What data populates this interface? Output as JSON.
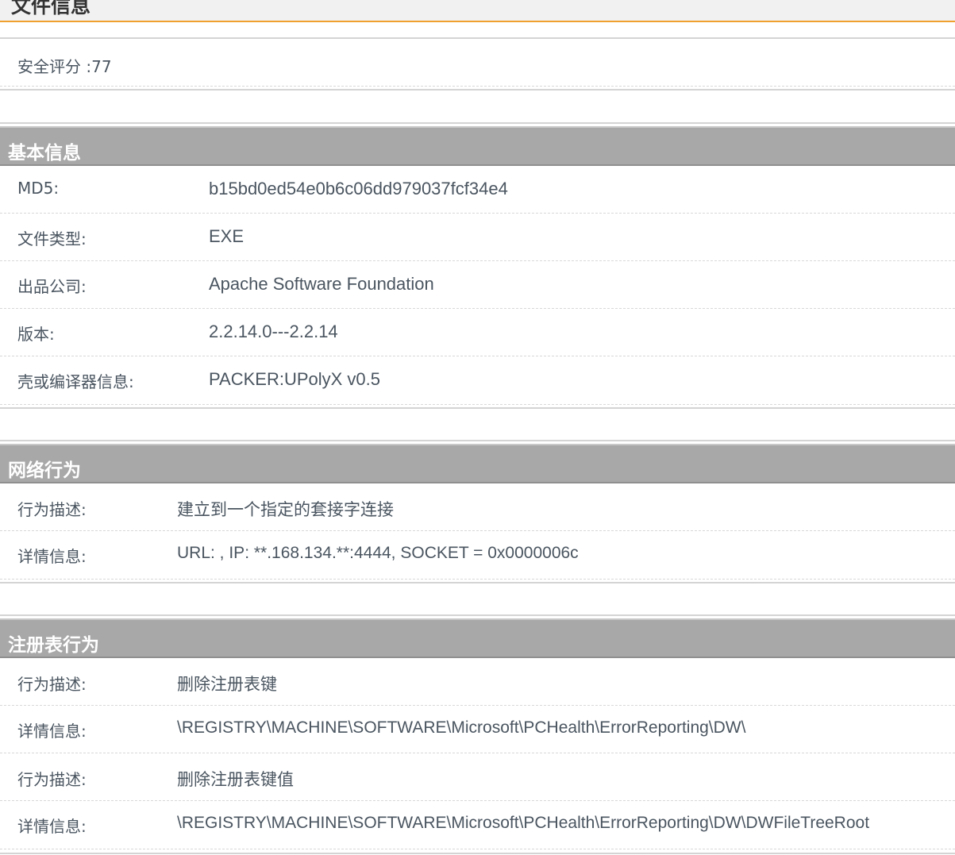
{
  "file_info": {
    "title": "文件信息",
    "security_score": "安全评分 :77"
  },
  "basic_info": {
    "title": "基本信息",
    "rows": [
      {
        "label": "MD5:",
        "value": "b15bd0ed54e0b6c06dd979037fcf34e4"
      },
      {
        "label": "文件类型:",
        "value": "EXE"
      },
      {
        "label": "出品公司:",
        "value": "Apache Software Foundation"
      },
      {
        "label": "版本:",
        "value": "2.2.14.0---2.2.14"
      },
      {
        "label": "壳或编译器信息:",
        "value": "PACKER:UPolyX v0.5"
      }
    ]
  },
  "network": {
    "title": "网络行为",
    "rows": [
      {
        "label": "行为描述:",
        "value": "建立到一个指定的套接字连接"
      },
      {
        "label": "详情信息:",
        "value": "URL: , IP: **.168.134.**:4444, SOCKET = 0x0000006c"
      }
    ]
  },
  "registry": {
    "title": "注册表行为",
    "rows": [
      {
        "label": "行为描述:",
        "value": "删除注册表键"
      },
      {
        "label": "详情信息:",
        "value": "\\REGISTRY\\MACHINE\\SOFTWARE\\Microsoft\\PCHealth\\ErrorReporting\\DW\\"
      },
      {
        "label": "行为描述:",
        "value": "删除注册表键值"
      },
      {
        "label": "详情信息:",
        "value": "\\REGISTRY\\MACHINE\\SOFTWARE\\Microsoft\\PCHealth\\ErrorReporting\\DW\\DWFileTreeRoot"
      }
    ]
  },
  "colors": {
    "accent": "#f0a02e",
    "section_header_bg": "#a8a8a8",
    "text": "#4a5560"
  }
}
